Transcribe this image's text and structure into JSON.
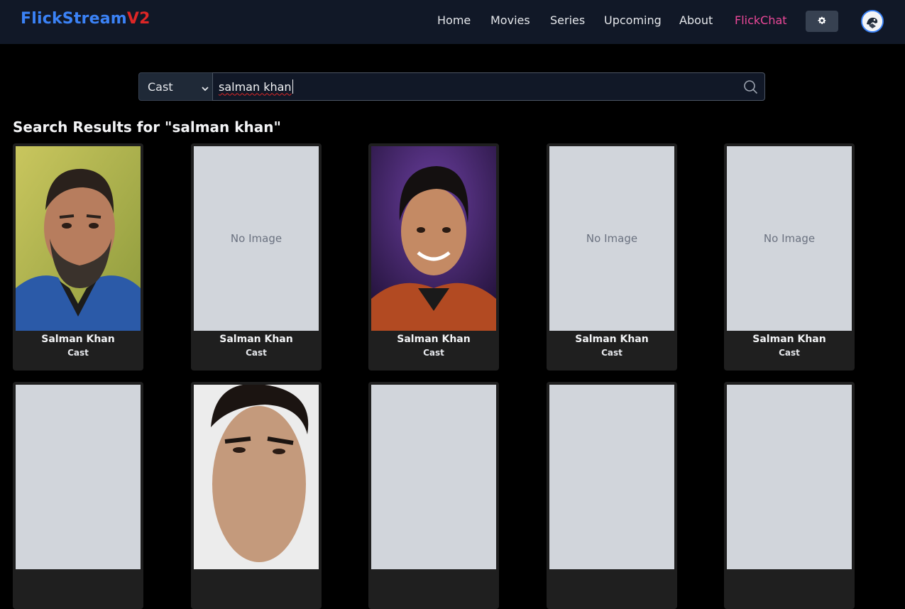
{
  "brand": {
    "part1": "FlickStream",
    "part2": "V2"
  },
  "nav": {
    "links": [
      "Home",
      "Movies",
      "Series",
      "Upcoming",
      "About",
      "FlickChat"
    ]
  },
  "icons": {
    "theme": "gear-icon",
    "search": "search-icon",
    "select": "chevron-down-icon",
    "avatar": "avatar-icon"
  },
  "colors": {
    "brand_blue": "#3b82f6",
    "brand_red": "#dc2626",
    "flickchat": "#ec4899",
    "navbar_bg": "#111827",
    "page_bg": "#000000"
  },
  "search": {
    "type_selected": "Cast",
    "query": "salman khan"
  },
  "results": {
    "title": "Search Results for \"salman khan\"",
    "no_image_label": "No Image",
    "row1": [
      {
        "name": "Salman Khan",
        "role": "Cast",
        "image": "photo-man-beard"
      },
      {
        "name": "Salman Khan",
        "role": "Cast",
        "image": "none"
      },
      {
        "name": "Salman Khan",
        "role": "Cast",
        "image": "photo-man-smiling"
      },
      {
        "name": "Salman Khan",
        "role": "Cast",
        "image": "none"
      },
      {
        "name": "Salman Khan",
        "role": "Cast",
        "image": "none"
      }
    ],
    "row2": [
      {
        "image": "none"
      },
      {
        "image": "photo-man-closeup"
      },
      {
        "image": "none"
      },
      {
        "image": "none"
      },
      {
        "image": "none"
      }
    ]
  }
}
